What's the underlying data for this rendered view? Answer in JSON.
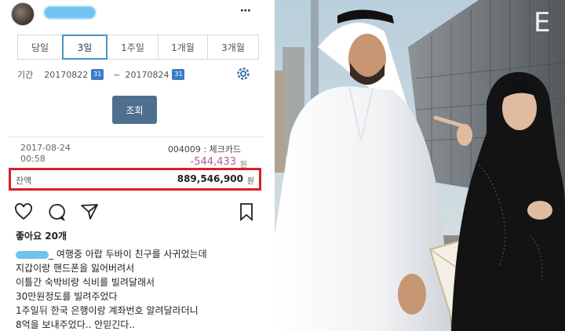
{
  "post": {
    "more_icon": "⋯",
    "tabs": [
      {
        "label": "당일",
        "active": false
      },
      {
        "label": "3일",
        "active": true
      },
      {
        "label": "1주일",
        "active": false
      },
      {
        "label": "1개월",
        "active": false
      },
      {
        "label": "3개월",
        "active": false
      }
    ],
    "period": {
      "label": "기간",
      "from": "20170822",
      "to": "20170824",
      "calendar_text": "31",
      "separator": "~"
    },
    "search_button": "조회",
    "transaction": {
      "date": "2017-08-24",
      "time": "00:58",
      "code": "004009 : 체크카드",
      "amount": "-544,433",
      "amount_unit": "원"
    },
    "balance": {
      "label": "잔액",
      "value": "889,546,900",
      "unit": "원"
    },
    "likes": "좋아요 20개",
    "caption_lines": [
      "_ 여행중 아랍 두바이 친구를 사귀었는데",
      "지갑이랑 핸드폰을 잃어버려서",
      "이틀간 숙박비랑 식비를 빌려달래서",
      "30만원정도를 빌려주었다",
      "1주일뒤 한국 은행이랑 계좌번호 알려달라더니",
      "8억을 보내주었다.. 안믿긴다.."
    ]
  },
  "colors": {
    "accent": "#4a93c4",
    "highlight": "#d8202a",
    "button": "#4f6f8f",
    "amount": "#b05aa0",
    "blur": "#6ec3ef"
  }
}
